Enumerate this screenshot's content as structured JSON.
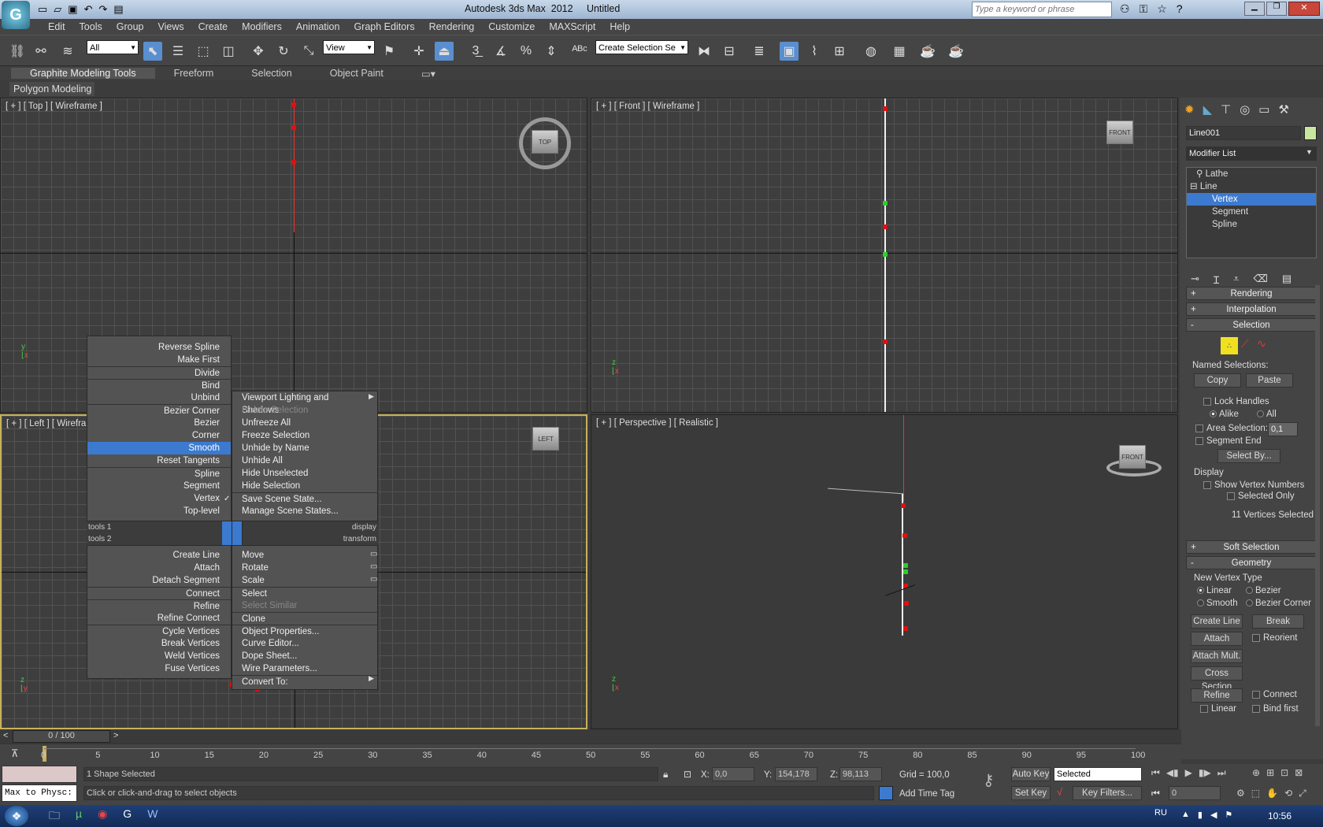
{
  "titlebar": {
    "title": "Autodesk 3ds Max  2012     Untitled",
    "search_placeholder": "Type a keyword or phrase"
  },
  "menubar": [
    "Edit",
    "Tools",
    "Group",
    "Views",
    "Create",
    "Modifiers",
    "Animation",
    "Graph Editors",
    "Rendering",
    "Customize",
    "MAXScript",
    "Help"
  ],
  "toolbar": {
    "selection_filter": "All",
    "ref_coord": "View",
    "named_selection": "Create Selection Se"
  },
  "ribbon": {
    "tabs": [
      "Graphite Modeling Tools",
      "Freeform",
      "Selection",
      "Object Paint"
    ],
    "sub_label": "Polygon Modeling"
  },
  "viewports": {
    "top": "[ + ] [ Top ] [ Wireframe ]",
    "front": "[ + ] [ Front ] [ Wireframe ]",
    "left": "[ + ] [ Left ] [ Wirefram",
    "perspective": "[ + ] [ Perspective ] [ Realistic ]",
    "navcube_top": "TOP",
    "navcube_front": "FRONT",
    "navcube_left": "LEFT",
    "navcube_persp": "FRONT"
  },
  "quadmenu": {
    "left_upper": [
      "Reverse Spline",
      "Make First",
      "Divide",
      "Bind",
      "Unbind",
      "Bezier Corner",
      "Bezier",
      "Corner",
      "Smooth",
      "Reset Tangents",
      "Spline",
      "Segment",
      "Vertex",
      "Top-level"
    ],
    "right_upper": [
      "Viewport Lighting and Shadows",
      "Isolate Selection",
      "Unfreeze All",
      "Freeze Selection",
      "Unhide by Name",
      "Unhide All",
      "Hide Unselected",
      "Hide Selection",
      "Save Scene State...",
      "Manage Scene States..."
    ],
    "hdr_tools1": "tools 1",
    "hdr_display": "display",
    "hdr_tools2": "tools 2",
    "hdr_transform": "transform",
    "left_lower": [
      "Create Line",
      "Attach",
      "Detach Segment",
      "Connect",
      "Refine",
      "Refine Connect",
      "Cycle Vertices",
      "Break Vertices",
      "Weld Vertices",
      "Fuse Vertices"
    ],
    "right_lower": [
      "Move",
      "Rotate",
      "Scale",
      "Select",
      "Select Similar",
      "Clone",
      "Object Properties...",
      "Curve Editor...",
      "Dope Sheet...",
      "Wire Parameters...",
      "Convert To:"
    ]
  },
  "cmdpanel": {
    "object_name": "Line001",
    "modifier_list": "Modifier List",
    "stack": [
      "Lathe",
      "Line",
      "Vertex",
      "Segment",
      "Spline"
    ],
    "rollouts": {
      "rendering": "Rendering",
      "interpolation": "Interpolation",
      "selection": "Selection",
      "soft_selection": "Soft Selection",
      "geometry": "Geometry"
    },
    "named_selections": "Named Selections:",
    "copy": "Copy",
    "paste": "Paste",
    "lock_handles": "Lock Handles",
    "alike": "Alike",
    "all": "All",
    "area_selection": "Area Selection:",
    "area_value": "0,1",
    "segment_end": "Segment End",
    "select_by": "Select By...",
    "display": "Display",
    "show_vertex_numbers": "Show Vertex Numbers",
    "selected_only": "Selected Only",
    "vertices_selected": "11 Vertices Selected",
    "new_vertex_type": "New Vertex Type",
    "linear": "Linear",
    "bezier": "Bezier",
    "smooth": "Smooth",
    "bezier_corner": "Bezier Corner",
    "create_line": "Create Line",
    "break": "Break",
    "attach": "Attach",
    "reorient": "Reorient",
    "attach_mult": "Attach Mult.",
    "cross_section": "Cross Section",
    "refine": "Refine",
    "connect": "Connect",
    "linear2": "Linear",
    "bind_first": "Bind first"
  },
  "timeline": {
    "frame": "0 / 100",
    "ticks": [
      "0",
      "5",
      "10",
      "15",
      "20",
      "25",
      "30",
      "35",
      "40",
      "45",
      "50",
      "55",
      "60",
      "65",
      "70",
      "75",
      "80",
      "85",
      "90",
      "95",
      "100"
    ]
  },
  "status": {
    "maxscript": "Max to Physc:",
    "selected": "1 Shape Selected",
    "prompt": "Click or click-and-drag to select objects",
    "x_label": "X:",
    "x": "0,0",
    "y_label": "Y:",
    "y": "154,178",
    "z_label": "Z:",
    "z": "98,113",
    "grid": "Grid = 100,0",
    "add_time_tag": "Add Time Tag",
    "auto_key": "Auto Key",
    "set_key": "Set Key",
    "key_mode": "Selected",
    "key_filters": "Key Filters...",
    "frame_field": "0"
  },
  "taskbar": {
    "lang": "RU",
    "time": "10:56"
  }
}
